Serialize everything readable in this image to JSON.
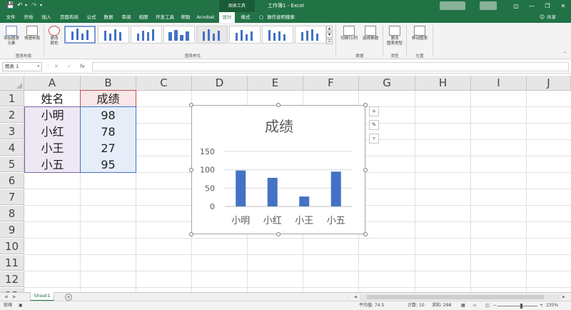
{
  "app": {
    "chart_tools_label": "图表工具",
    "doc_title": "工作簿1  -  Excel"
  },
  "ribbon": {
    "tabs": [
      "文件",
      "开始",
      "插入",
      "页面布局",
      "公式",
      "数据",
      "审阅",
      "视图",
      "开发工具",
      "帮助",
      "Acrobat",
      "设计",
      "格式"
    ],
    "active_tab": "设计",
    "tell_me": "操作说明搜索",
    "share": "共享",
    "buttons": {
      "add_element_1": "添加图表",
      "add_element_2": "元素",
      "quick_layout_1": "快速布局",
      "change_colors_1": "更改",
      "change_colors_2": "颜色",
      "switch_row_col": "切换行/列",
      "select_data": "选择数据",
      "change_type_1": "更改",
      "change_type_2": "图表类型",
      "move_chart": "移动图表"
    },
    "groups": {
      "layout": "图表布局",
      "styles": "图表样式",
      "data": "数据",
      "type": "类型",
      "location": "位置"
    }
  },
  "formula_bar": {
    "name_box": "图表 1",
    "fx": "fx",
    "value": ""
  },
  "sheet": {
    "columns": [
      "A",
      "B",
      "C",
      "D",
      "E",
      "F",
      "G",
      "H",
      "I",
      "J"
    ],
    "rows": [
      "1",
      "2",
      "3",
      "4",
      "5",
      "6",
      "7",
      "8",
      "9",
      "10",
      "11",
      "12",
      "13"
    ],
    "header_row": [
      "姓名",
      "成绩"
    ],
    "data_rows": [
      [
        "小明",
        "98"
      ],
      [
        "小红",
        "78"
      ],
      [
        "小王",
        "27"
      ],
      [
        "小五",
        "95"
      ]
    ]
  },
  "chart_data": {
    "type": "bar",
    "title": "成绩",
    "categories": [
      "小明",
      "小红",
      "小王",
      "小五"
    ],
    "values": [
      98,
      78,
      27,
      95
    ],
    "yticks": [
      "150",
      "100",
      "50",
      "0"
    ],
    "ylim": [
      0,
      150
    ],
    "grid": true,
    "legend": "none",
    "bar_color": "#4472c4"
  },
  "sheet_tabs": {
    "active": "Sheet1"
  },
  "status": {
    "mode": "就绪",
    "average": "平均值: 74.5",
    "count": "计数: 10",
    "sum": "求和: 298",
    "zoom": "235%"
  },
  "colors": {
    "excel_green": "#217346",
    "series_blue": "#4472c4"
  }
}
